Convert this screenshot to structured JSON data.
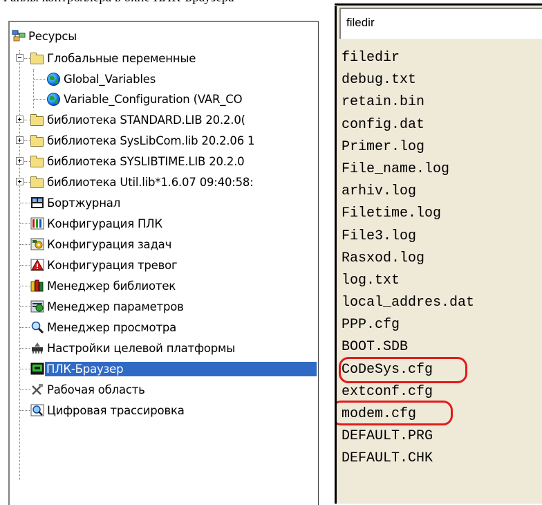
{
  "top_cut_text": "Файлы контроллера в окне ПЛК-Браузера",
  "tree": {
    "root": "Ресурсы",
    "items": [
      {
        "label": "Глобальные переменные"
      },
      {
        "label": "Global_Variables"
      },
      {
        "label": "Variable_Configuration (VAR_CO"
      },
      {
        "label": "библиотека STANDARD.LIB 20.2.0("
      },
      {
        "label": "библиотека SysLibCom.lib 20.2.06 1"
      },
      {
        "label": "библиотека SYSLIBTIME.LIB 20.2.0"
      },
      {
        "label": "библиотека Util.lib*1.6.07 09:40:58:"
      },
      {
        "label": "Бортжурнал"
      },
      {
        "label": "Конфигурация ПЛК"
      },
      {
        "label": "Конфигурация задач"
      },
      {
        "label": "Конфигурация тревог"
      },
      {
        "label": "Менеджер библиотек"
      },
      {
        "label": "Менеджер параметров"
      },
      {
        "label": "Менеджер просмотра"
      },
      {
        "label": "Настройки целевой платформы"
      },
      {
        "label": "ПЛК-Браузер"
      },
      {
        "label": "Рабочая область"
      },
      {
        "label": "Цифровая трассировка"
      }
    ],
    "selected": "ПЛК-Браузер"
  },
  "browser": {
    "path_value": "filedir",
    "files": [
      "filedir",
      "debug.txt",
      "retain.bin",
      "config.dat",
      "Primer.log",
      "File_name.log",
      "arhiv.log",
      "Filetime.log",
      "File3.log",
      "Rasxod.log",
      "log.txt",
      "local_addres.dat",
      "PPP.cfg",
      "BOOT.SDB",
      "CoDeSys.cfg",
      "extconf.cfg",
      "modem.cfg",
      "DEFAULT.PRG",
      "DEFAULT.CHK"
    ],
    "highlighted": [
      "CoDeSys.cfg",
      "modem.cfg"
    ],
    "highlight_color": "#e11b1b"
  },
  "colors": {
    "selection": "#316ac5",
    "list_background": "#efe9d8"
  },
  "icons": {
    "root": "resources-icon",
    "folder": "folder-icon",
    "globe": "globe-icon"
  }
}
